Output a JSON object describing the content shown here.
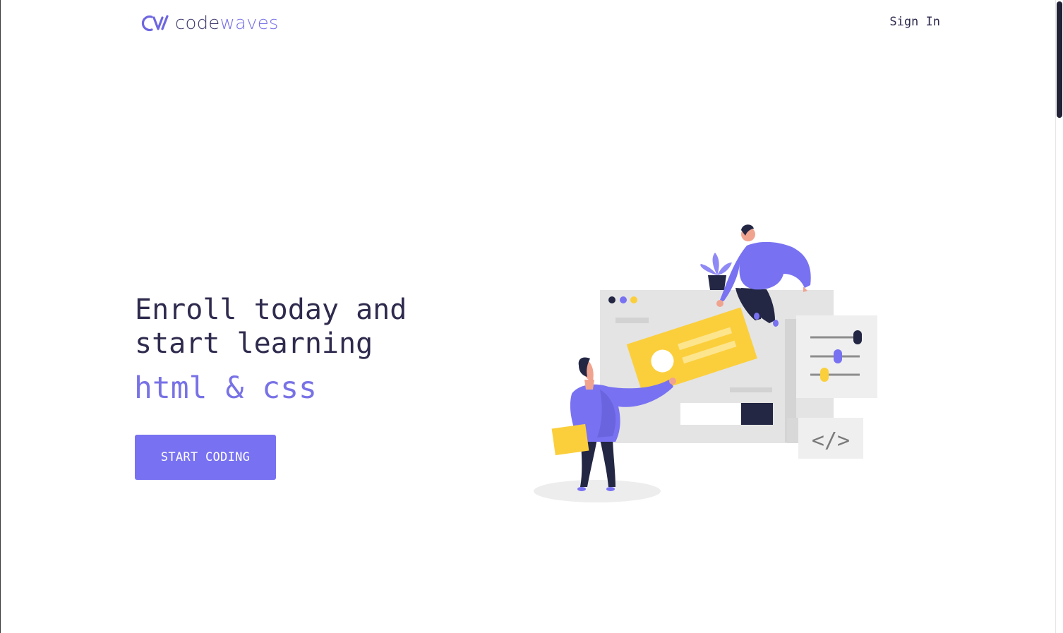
{
  "header": {
    "logo_code": "code",
    "logo_waves": "waves",
    "signin_label": "Sign In"
  },
  "hero": {
    "title": "Enroll today and start learning",
    "subject": "html & css",
    "cta_label": "START CODING"
  },
  "illustration": {
    "code_symbol": "</>"
  },
  "colors": {
    "accent": "#7872f2",
    "text_dark": "#2f2b4e",
    "yellow": "#fbcf3c",
    "navy": "#232744",
    "panel_gray": "#e4e4e4"
  },
  "icons": [
    "logo-mark-icon",
    "scrollbar"
  ]
}
